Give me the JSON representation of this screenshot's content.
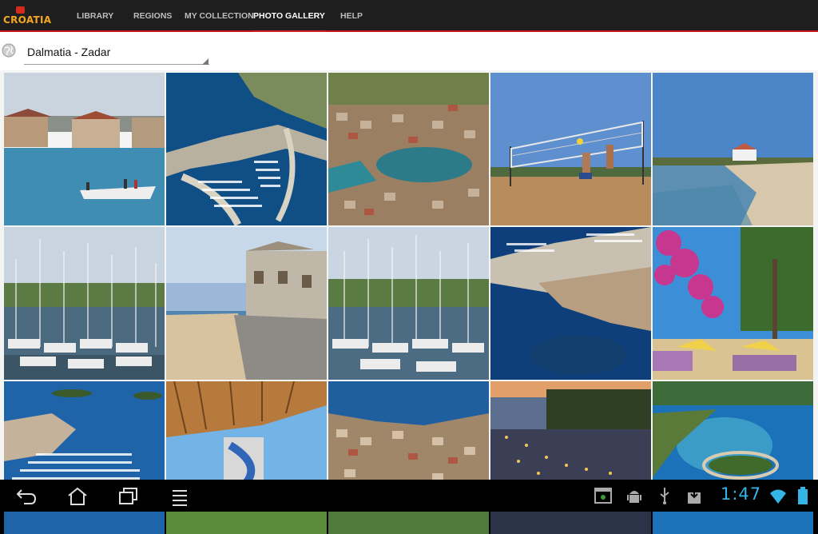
{
  "app": {
    "logo_text": "CROATIA",
    "nav": [
      {
        "label": "LIBRARY"
      },
      {
        "label": "REGIONS"
      },
      {
        "label": "MY COLLECTION"
      },
      {
        "label": "PHOTO GALLERY"
      },
      {
        "label": "HELP"
      }
    ],
    "active_tab": "PHOTO GALLERY"
  },
  "selector": {
    "value": "Dalmatia - Zadar"
  },
  "gallery": {
    "photos": [
      {
        "subject": "fishing boat near stone houses"
      },
      {
        "subject": "aerial marina"
      },
      {
        "subject": "aerial coastal town"
      },
      {
        "subject": "beach volleyball"
      },
      {
        "subject": "beach and sea"
      },
      {
        "subject": "sailboats in marina"
      },
      {
        "subject": "stone promenade"
      },
      {
        "subject": "sailboats in marina"
      },
      {
        "subject": "aerial peninsula town"
      },
      {
        "subject": "garden with bougainvillea"
      },
      {
        "subject": "aerial marina and islands"
      },
      {
        "subject": "water slide"
      },
      {
        "subject": "aerial town"
      },
      {
        "subject": "town at dusk"
      },
      {
        "subject": "aerial islet"
      }
    ]
  },
  "status_bar": {
    "time": "1:47"
  },
  "colors": {
    "accent_red": "#c8161d",
    "clock_blue": "#33b5e5"
  }
}
